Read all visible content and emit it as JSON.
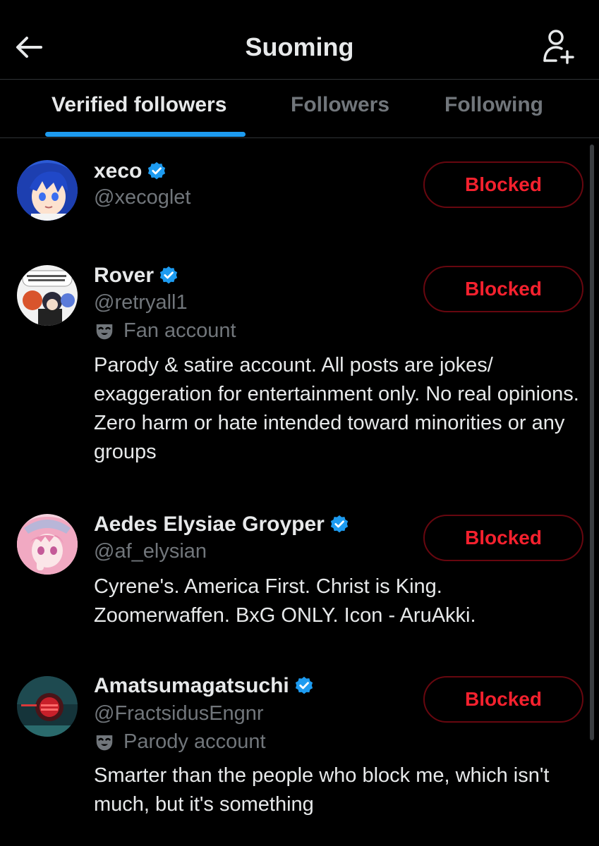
{
  "header": {
    "title": "Suoming",
    "back_icon": "arrow-left-icon",
    "add_icon": "add-user-icon"
  },
  "tabs": [
    {
      "label": "Verified followers",
      "active": true
    },
    {
      "label": "Followers",
      "active": false
    },
    {
      "label": "Following",
      "active": false
    }
  ],
  "colors": {
    "accent": "#1d9bf0",
    "blocked": "#f4212e",
    "muted": "#71767b",
    "background": "#000000"
  },
  "users": [
    {
      "name": "xeco",
      "handle": "@xecoglet",
      "verified": true,
      "button": "Blocked"
    },
    {
      "name": "Rover",
      "handle": "@retryall1",
      "verified": true,
      "label": "Fan account",
      "label_icon": "mask-icon",
      "bio": "Parody & satire account. All posts are jokes/ exaggeration for entertainment only. No real opinions. Zero harm or hate intended toward minorities or any groups",
      "button": "Blocked"
    },
    {
      "name": "Aedes Elysiae Groyper",
      "handle": "@af_elysian",
      "verified": true,
      "bio": "Cyrene's. America First. Christ is King. Zoomerwaffen. BxG ONLY. Icon - AruAkki.",
      "button": "Blocked"
    },
    {
      "name": "Amatsumagatsuchi",
      "handle": "@FractsidusEngnr",
      "verified": true,
      "label": "Parody account",
      "label_icon": "mask-icon",
      "bio": "Smarter than the people who block me, which isn't much, but it's something",
      "button": "Blocked"
    }
  ]
}
